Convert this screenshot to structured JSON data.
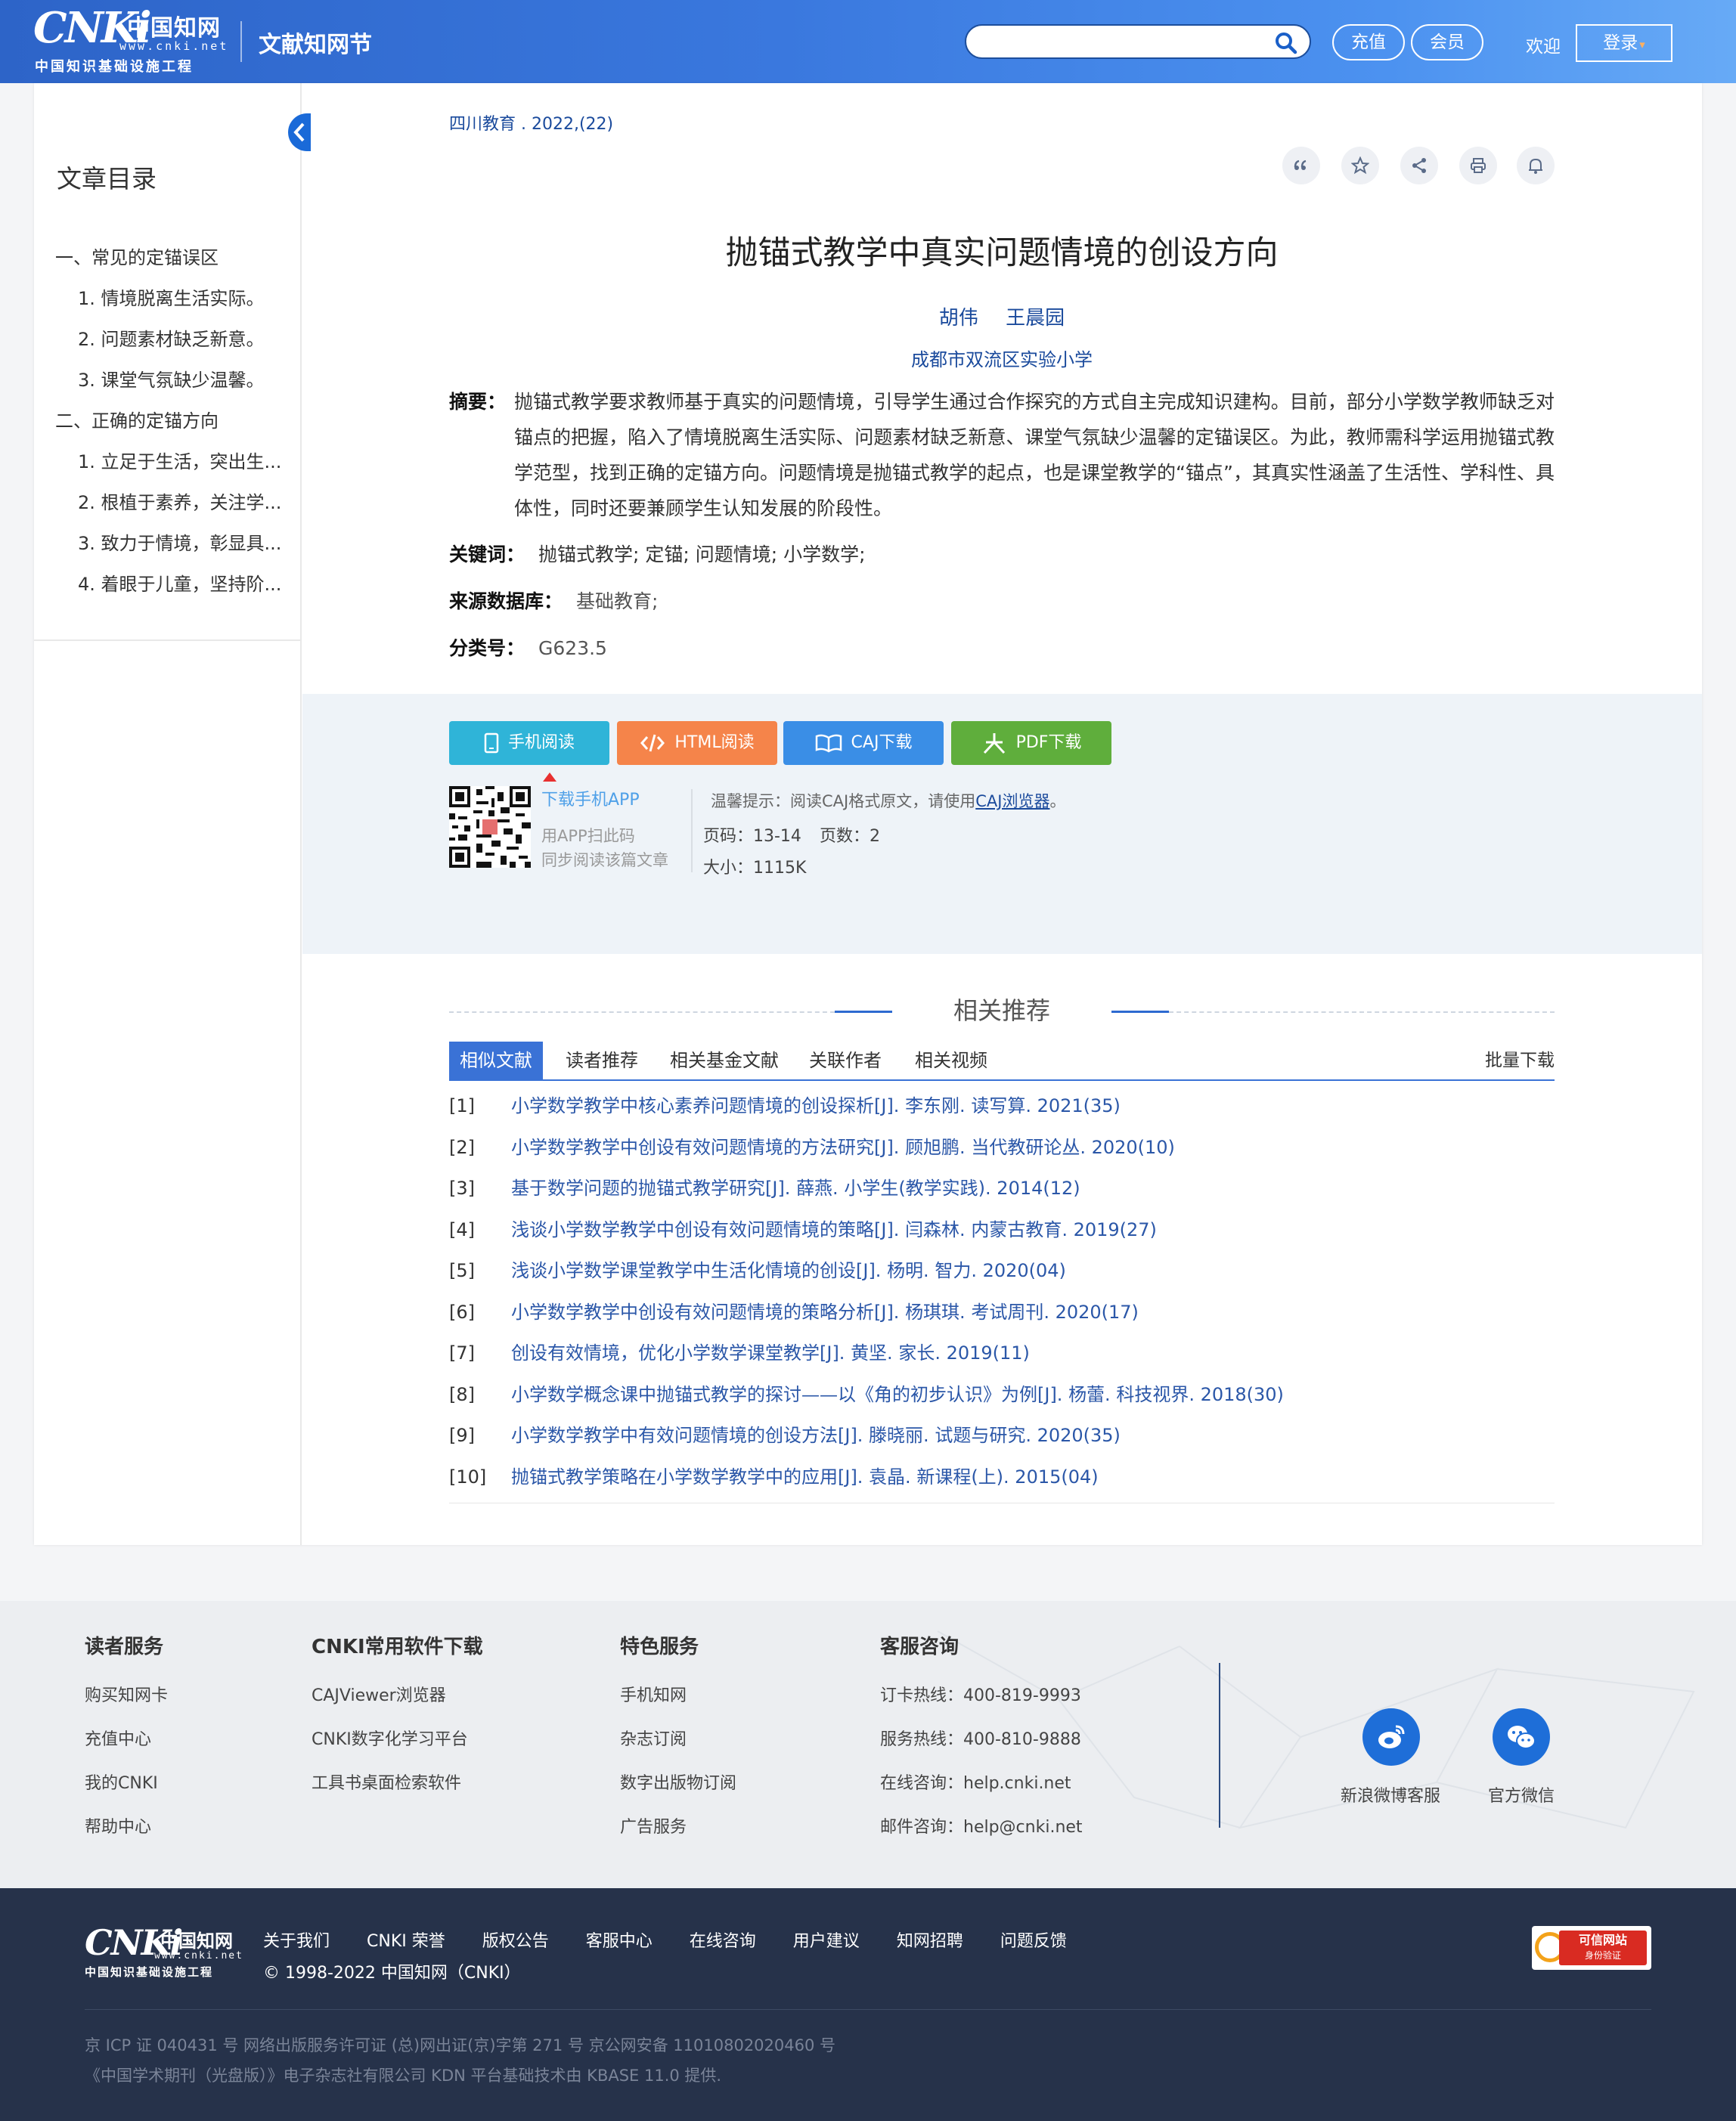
{
  "header": {
    "logo_mark": "CNKi",
    "logo_cn": "中国知网",
    "logo_url": "www.cnki.net",
    "logo_sub": "中国知识基础设施工程",
    "site_title": "文献知网节",
    "search_value": "",
    "recharge": "充值",
    "member": "会员",
    "welcome": "欢迎",
    "login": "登录"
  },
  "sidebar": {
    "title": "文章目录",
    "items": [
      {
        "label": "一、常见的定锚误区"
      },
      {
        "label": "1. 情境脱离生活实际。"
      },
      {
        "label": "2. 问题素材缺乏新意。"
      },
      {
        "label": "3. 课堂气氛缺少温馨。"
      },
      {
        "label": "二、正确的定锚方向"
      },
      {
        "label": "1. 立足于生活，突出生..."
      },
      {
        "label": "2. 根植于素养，关注学..."
      },
      {
        "label": "3. 致力于情境，彰显具..."
      },
      {
        "label": "4. 着眼于儿童，坚持阶..."
      }
    ]
  },
  "article": {
    "source": "四川教育 . 2022,(22)",
    "title": "抛锚式教学中真实问题情境的创设方向",
    "authors": [
      "胡伟",
      "王晨园"
    ],
    "org": "成都市双流区实验小学",
    "abstract_label": "摘要：",
    "abstract": "抛锚式教学要求教师基于真实的问题情境，引导学生通过合作探究的方式自主完成知识建构。目前，部分小学数学教师缺乏对锚点的把握，陷入了情境脱离生活实际、问题素材缺乏新意、课堂气氛缺少温馨的定锚误区。为此，教师需科学运用抛锚式教学范型，找到正确的定锚方向。问题情境是抛锚式教学的起点，也是课堂教学的“锚点”，其真实性涵盖了生活性、学科性、具体性，同时还要兼顾学生认知发展的阶段性。",
    "keywords_label": "关键词：",
    "keywords": "抛锚式教学;  定锚;  问题情境;  小学数学;",
    "db_label": "来源数据库：",
    "db": "基础教育;",
    "class_label": "分类号：",
    "class": "G623.5"
  },
  "download": {
    "mobile": "手机阅读",
    "html": "HTML阅读",
    "caj": "CAJ下载",
    "pdf": "PDF下载",
    "app_link": "下载手机APP",
    "scan1": "用APP扫此码",
    "scan2": "同步阅读该篇文章",
    "tip_prefix": "温馨提示：阅读CAJ格式原文，请使用",
    "tip_link": "CAJ浏览器",
    "tip_suffix": "。",
    "pages": "页码：13-14",
    "page_count": "页数：2",
    "size": "大小：1115K"
  },
  "related": {
    "title": "相关推荐",
    "tabs": [
      "相似文献",
      "读者推荐",
      "相关基金文献",
      "关联作者",
      "相关视频"
    ],
    "batch": "批量下载",
    "refs": [
      {
        "n": "[1]",
        "t": "小学数学教学中核心素养问题情境的创设探析",
        "m": "[J]. 李东刚.  读写算. 2021(35)"
      },
      {
        "n": "[2]",
        "t": "小学数学教学中创设有效问题情境的方法研究",
        "m": "[J]. 顾旭鹏.  当代教研论丛. 2020(10)"
      },
      {
        "n": "[3]",
        "t": "基于数学问题的抛锚式教学研究",
        "m": "[J]. 薛燕.  小学生(教学实践). 2014(12)"
      },
      {
        "n": "[4]",
        "t": "浅谈小学数学教学中创设有效问题情境的策略",
        "m": "[J]. 闫森林.  内蒙古教育. 2019(27)"
      },
      {
        "n": "[5]",
        "t": "浅谈小学数学课堂教学中生活化情境的创设",
        "m": "[J]. 杨明.  智力. 2020(04)"
      },
      {
        "n": "[6]",
        "t": "小学数学教学中创设有效问题情境的策略分析",
        "m": "[J]. 杨琪琪.  考试周刊. 2020(17)"
      },
      {
        "n": "[7]",
        "t": "创设有效情境，优化小学数学课堂教学",
        "m": "[J]. 黄坚.  家长. 2019(11)"
      },
      {
        "n": "[8]",
        "t": "小学数学概念课中抛锚式教学的探讨——以《角的初步认识》为例",
        "m": "[J]. 杨蕾.  科技视界. 2018(30)"
      },
      {
        "n": "[9]",
        "t": "小学数学教学中有效问题情境的创设方法",
        "m": "[J]. 滕晓丽.  试题与研究. 2020(35)"
      },
      {
        "n": "[10]",
        "t": "抛锚式教学策略在小学数学教学中的应用",
        "m": "[J]. 袁晶.  新课程(上). 2015(04)"
      }
    ]
  },
  "footer": {
    "col1": {
      "title": "读者服务",
      "items": [
        "购买知网卡",
        "充值中心",
        "我的CNKI",
        "帮助中心"
      ]
    },
    "col2": {
      "title": "CNKI常用软件下载",
      "items": [
        "CAJViewer浏览器",
        "CNKI数字化学习平台",
        "工具书桌面检索软件"
      ]
    },
    "col3": {
      "title": "特色服务",
      "items": [
        "手机知网",
        "杂志订阅",
        "数字出版物订阅",
        "广告服务"
      ]
    },
    "col4": {
      "title": "客服咨询",
      "items": [
        "订卡热线：400-819-9993",
        "服务热线：400-810-9888",
        "在线咨询：help.cnki.net",
        "邮件咨询：help@cnki.net"
      ]
    },
    "weibo": "新浪微博客服",
    "wechat": "官方微信",
    "links": [
      "关于我们",
      "CNKI 荣誉",
      "版权公告",
      "客服中心",
      "在线咨询",
      "用户建议",
      "知网招聘",
      "问题反馈"
    ],
    "copyright": "© 1998-2022 中国知网（CNKI）",
    "badge_line1": "可信网站",
    "badge_line2": "身份验证",
    "icp1": "京 ICP 证 040431 号  网络出版服务许可证 (总)网出证(京)字第 271 号  京公网安备 11010802020460 号",
    "icp2": "《中国学术期刊（光盘版）》电子杂志社有限公司 KDN 平台基础技术由 KBASE 11.0 提供."
  },
  "colors": {
    "header_blue": "#3a78de",
    "btn_mobile": "#2fb4d8",
    "btn_html": "#f5844a",
    "btn_caj": "#3a8ee6",
    "btn_pdf": "#5fae3c",
    "link_blue": "#2b57a8",
    "footer_dark": "#26324a"
  }
}
